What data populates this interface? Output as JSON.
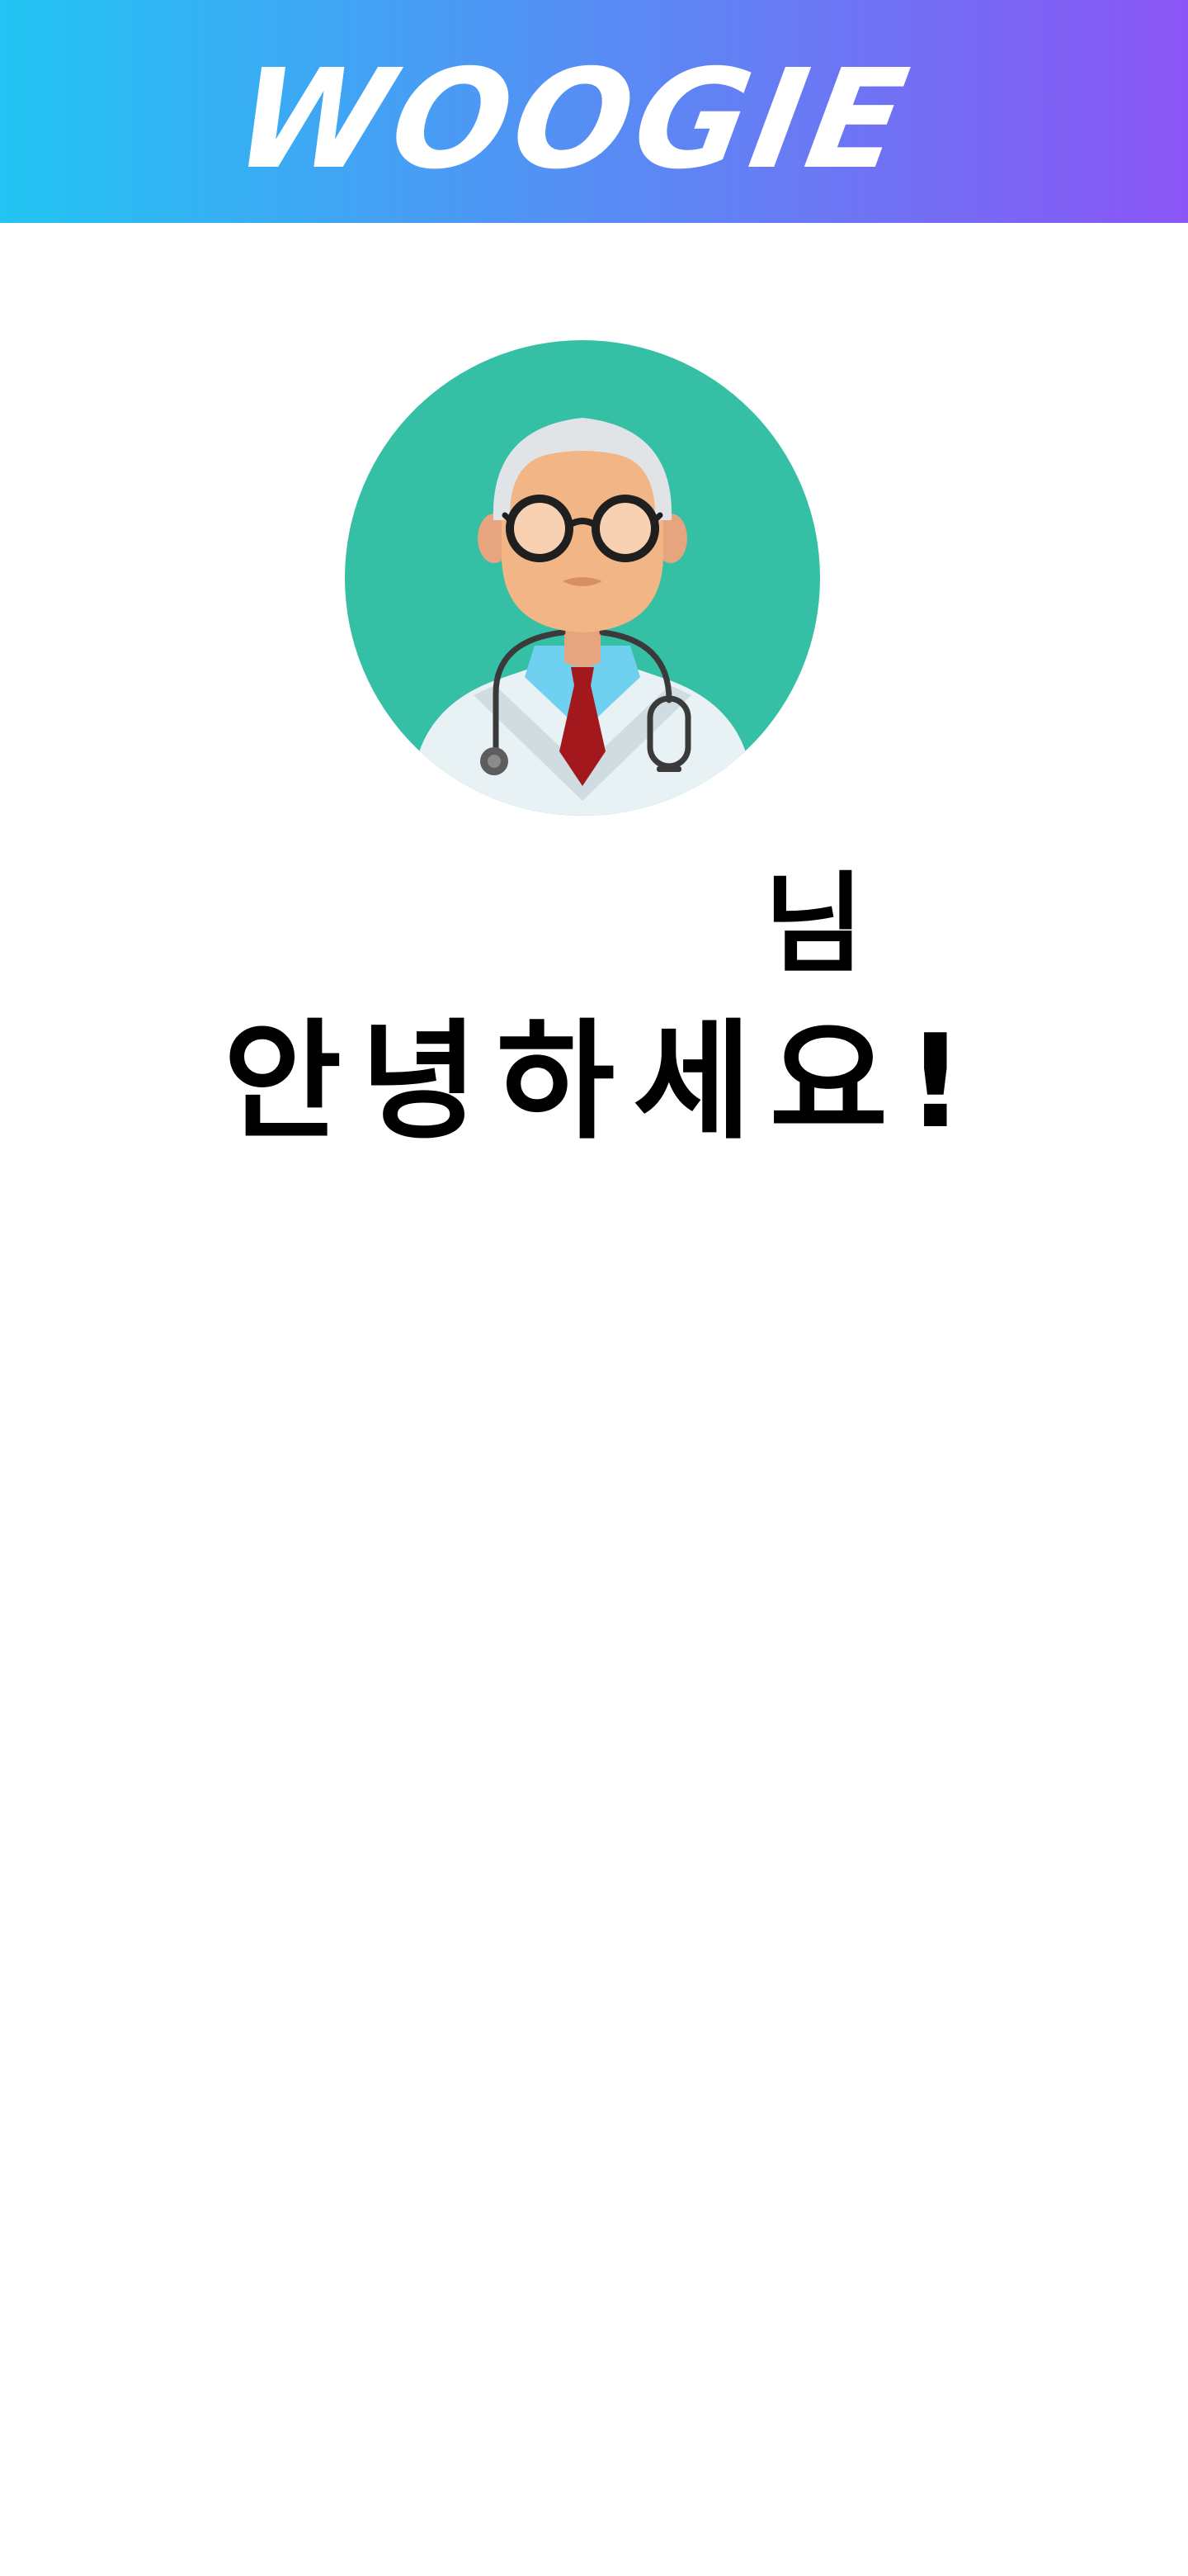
{
  "header": {
    "logo_text": "WOOGIE",
    "gradient_start": "#22c5f3",
    "gradient_end": "#8b55f5"
  },
  "profile": {
    "avatar_icon": "doctor-avatar-icon",
    "user_name": "",
    "honorific": "님"
  },
  "greeting": {
    "text": "안녕하세요!"
  },
  "colors": {
    "avatar_background": "#35bfa4",
    "coat": "#e8f1f4",
    "tie": "#a3181c",
    "text": "#000000"
  }
}
